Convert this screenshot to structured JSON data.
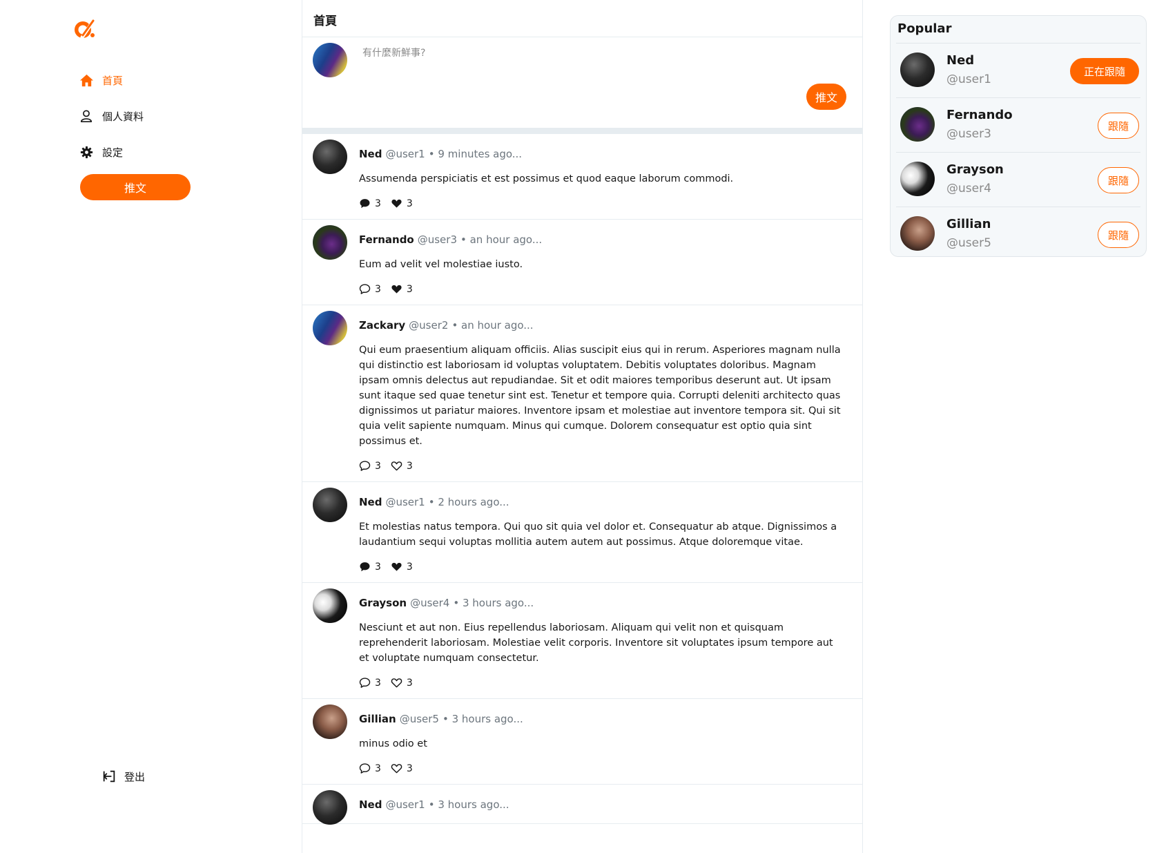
{
  "sidebar": {
    "nav": [
      {
        "label": "首頁",
        "icon": "home-icon",
        "active": true
      },
      {
        "label": "個人資料",
        "icon": "user-icon",
        "active": false
      },
      {
        "label": "設定",
        "icon": "gear-icon",
        "active": false
      }
    ],
    "tweet_button": "推文",
    "logout": "登出"
  },
  "main": {
    "title": "首頁",
    "composer": {
      "placeholder": "有什麼新鮮事?",
      "button": "推文"
    },
    "tweets": [
      {
        "name": "Ned",
        "handle": "@user1",
        "time": "• 9 minutes ago...",
        "body": "Assumenda perspiciatis et est possimus et quod eaque laborum commodi.",
        "replies": "3",
        "likes": "3",
        "replied": true,
        "liked": true
      },
      {
        "name": "Fernando",
        "handle": "@user3",
        "time": "• an hour ago...",
        "body": "Eum ad velit vel molestiae iusto.",
        "replies": "3",
        "likes": "3",
        "replied": false,
        "liked": true
      },
      {
        "name": "Zackary",
        "handle": "@user2",
        "time": "• an hour ago...",
        "body": "Qui eum praesentium aliquam officiis. Alias suscipit eius qui in rerum. Asperiores magnam nulla qui distinctio est laboriosam id voluptas voluptatem. Debitis voluptates doloribus. Magnam ipsam omnis delectus aut repudiandae. Sit et odit maiores temporibus deserunt aut. Ut ipsam sunt itaque sed quae tenetur sint est. Tenetur et tempore quia. Corrupti deleniti architecto quas dignissimos ut pariatur maiores. Inventore ipsam et molestiae aut inventore tempora sit. Qui sit quia velit sapiente numquam. Minus qui cumque. Dolorem consequatur est optio quia sint possimus et.",
        "replies": "3",
        "likes": "3",
        "replied": false,
        "liked": false
      },
      {
        "name": "Ned",
        "handle": "@user1",
        "time": "• 2 hours ago...",
        "body": "Et molestias natus tempora. Qui quo sit quia vel dolor et. Consequatur ab atque. Dignissimos a laudantium sequi voluptas mollitia autem autem aut possimus. Atque doloremque vitae.",
        "replies": "3",
        "likes": "3",
        "replied": true,
        "liked": true
      },
      {
        "name": "Grayson",
        "handle": "@user4",
        "time": "• 3 hours ago...",
        "body": "Nesciunt et aut non. Eius repellendus laboriosam. Aliquam qui velit non et quisquam reprehenderit laboriosam. Molestiae velit corporis. Inventore sit voluptates ipsum tempore aut et voluptate numquam consectetur.",
        "replies": "3",
        "likes": "3",
        "replied": false,
        "liked": false
      },
      {
        "name": "Gillian",
        "handle": "@user5",
        "time": "• 3 hours ago...",
        "body": "minus odio et",
        "replies": "3",
        "likes": "3",
        "replied": false,
        "liked": false
      },
      {
        "name": "Ned",
        "handle": "@user1",
        "time": "• 3 hours ago...",
        "body": "",
        "replies": "",
        "likes": "",
        "replied": false,
        "liked": false
      }
    ]
  },
  "popular": {
    "title": "Popular",
    "users": [
      {
        "name": "Ned",
        "handle": "@user1",
        "button": "正在跟隨",
        "following": true
      },
      {
        "name": "Fernando",
        "handle": "@user3",
        "button": "跟隨",
        "following": false
      },
      {
        "name": "Grayson",
        "handle": "@user4",
        "button": "跟隨",
        "following": false
      },
      {
        "name": "Gillian",
        "handle": "@user5",
        "button": "跟隨",
        "following": false
      }
    ]
  },
  "colors": {
    "accent": "#ff6600",
    "border": "#e6ecf0",
    "muted": "#6c757d"
  }
}
